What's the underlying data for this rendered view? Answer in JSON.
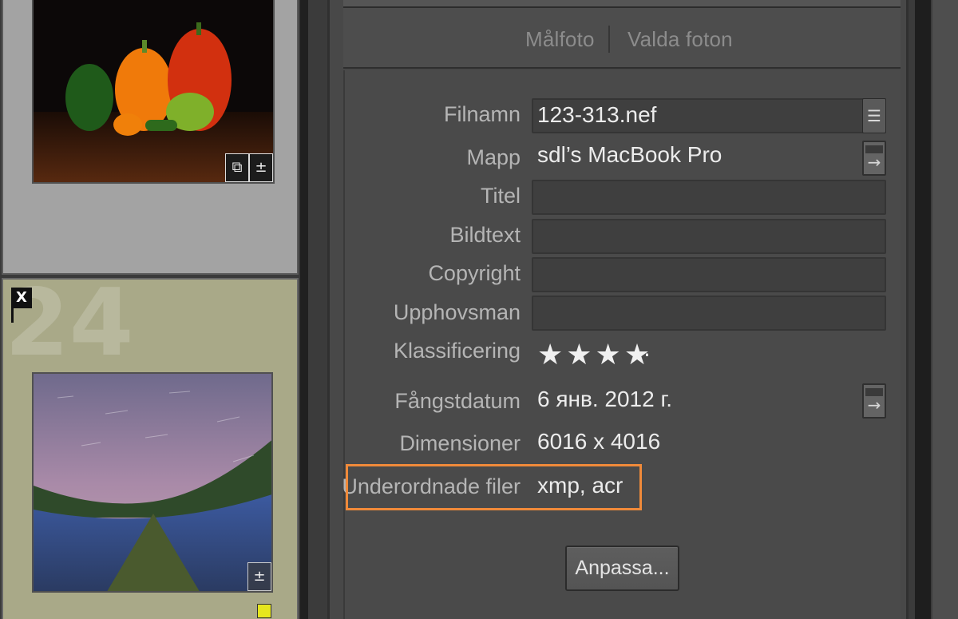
{
  "filmstrip": {
    "top_cell": {
      "badges": [
        "⧉",
        "±"
      ]
    },
    "selected_cell": {
      "number": "24",
      "flag": "X",
      "badge": "±",
      "color_label": "#e6e61e"
    }
  },
  "header": {
    "tab_target": "Målfoto",
    "tab_selected": "Valda foton"
  },
  "metadata": {
    "filename_label": "Filnamn",
    "filename_value": "123-313.nef",
    "folder_label": "Mapp",
    "folder_value": "sdl’s MacBook Pro",
    "title_label": "Titel",
    "title_value": "",
    "caption_label": "Bildtext",
    "caption_value": "",
    "copyright_label": "Copyright",
    "copyright_value": "",
    "creator_label": "Upphovsman",
    "creator_value": "",
    "rating_label": "Klassificering",
    "rating_stars": "★★★★",
    "rating_rest": "·",
    "rating_value": 4,
    "capture_label": "Fångstdatum",
    "capture_value": "6 янв. 2012 г.",
    "dimensions_label": "Dimensioner",
    "dimensions_value": "6016 x 4016",
    "sidecar_label": "Underordnade filer",
    "sidecar_value": "xmp, acr"
  },
  "buttons": {
    "customize": "Anpassa..."
  },
  "colors": {
    "highlight": "#f08a3a",
    "panel": "#4a4a4a"
  }
}
